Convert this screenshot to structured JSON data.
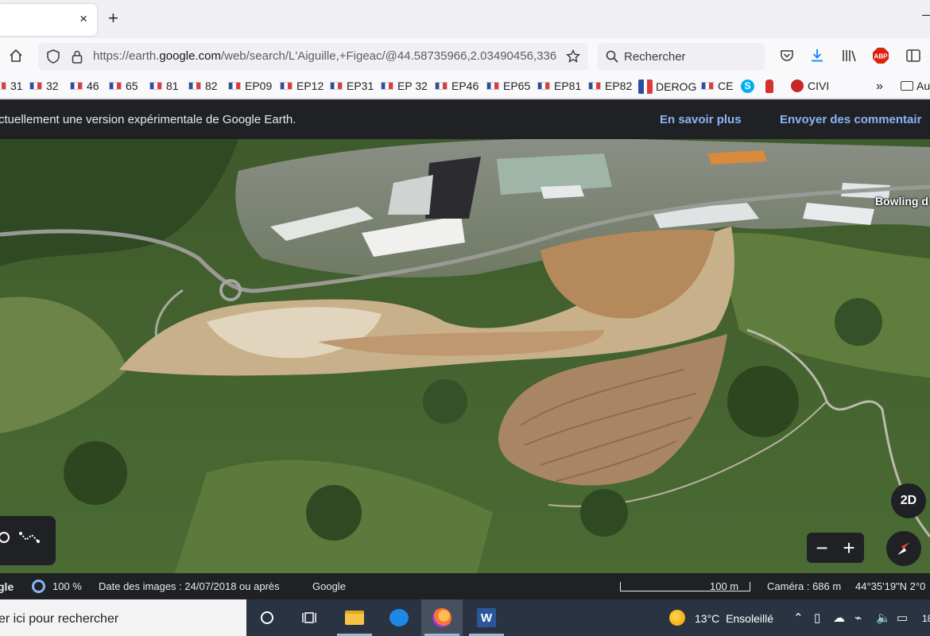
{
  "browser": {
    "tab": {
      "close": "×"
    },
    "new_tab": "+",
    "window_min": "–",
    "url": {
      "prefix": "https://earth.",
      "host": "google.com",
      "path": "/web/search/L'Aiguille,+Figeac/@44.58735966,2.03490456,336"
    },
    "search": {
      "placeholder": "Rechercher"
    },
    "bookmarks": [
      "31",
      "32",
      "46",
      "65",
      "81",
      "82",
      "EP09",
      "EP12",
      "EP31",
      "EP 32",
      "EP46",
      "EP65",
      "EP81",
      "EP82",
      "DEROG",
      "CE",
      "CIVI"
    ],
    "bookmarks_overflow": "»",
    "bookmarks_folder": "Au"
  },
  "earth": {
    "banner": {
      "text": "ctuellement une version expérimentale de Google Earth.",
      "learn_more": "En savoir plus",
      "feedback": "Envoyer des commentair"
    },
    "map": {
      "place_label": "Bowling d",
      "btn_2d": "2D",
      "zoom_out": "−",
      "zoom_in": "+"
    },
    "status": {
      "logo": "gle",
      "loaded_pct": "100 %",
      "imagery_date": "Date des images : 24/07/2018 ou après",
      "provider": "Google",
      "scale": "100 m",
      "camera": "Caméra : 686 m",
      "coords": "44°35'19\"N 2°0"
    }
  },
  "taskbar": {
    "search_placeholder": "er ici pour rechercher",
    "weather": {
      "temp": "13°C",
      "condition": "Ensoleillé"
    },
    "clock": "18"
  },
  "colors": {
    "banner_bg": "#202124",
    "link": "#8ab4f8",
    "taskbar_bg": "#2a3341"
  }
}
